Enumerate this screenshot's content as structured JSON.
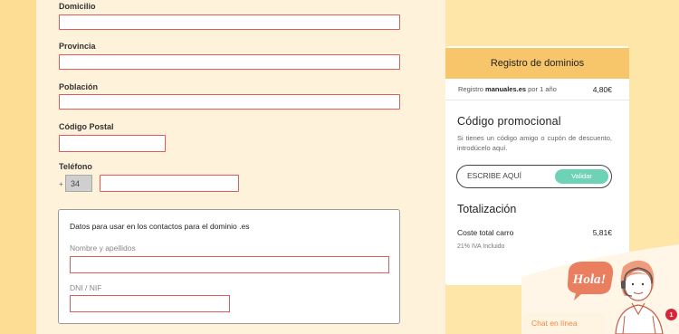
{
  "form": {
    "domicilio_label": "Domicilio",
    "provincia_label": "Provincia",
    "poblacion_label": "Población",
    "codigo_postal_label": "Código Postal",
    "telefono_label": "Teléfono",
    "telefono_plus": "+",
    "telefono_prefix": "34"
  },
  "contact_box": {
    "title": "Datos para usar en los contactos para el dominio .es",
    "nombre_label": "Nombre y apellidos",
    "dni_label": "DNI / NIF"
  },
  "cart": {
    "header": "Registro de dominios",
    "line_prefix": "Registro",
    "line_domain": "manuales.es",
    "line_suffix": "por 1 año",
    "line_price": "4,80€",
    "promo_title": "Código promocional",
    "promo_text": "Si tienes un código amigo o cupón de descuento, introdúcelo aquí.",
    "promo_placeholder": "ESCRIBE AQUÍ",
    "validar_label": "Validar",
    "totals_title": "Totalización",
    "total_label": "Coste total carro",
    "total_value": "5,81€",
    "iva_note": "21% IVA Incluido"
  },
  "chat": {
    "greeting": "Hola!",
    "label": "Chat en línea",
    "badge_count": "1"
  },
  "colors": {
    "page_bg": "#fde4a0",
    "form_bg": "#fff2da",
    "error_border": "#e35a5a",
    "cart_header": "#f8c66a",
    "validar_button": "#6ed3b6",
    "chat_accent": "#e58a45",
    "notification": "#d6263a"
  }
}
